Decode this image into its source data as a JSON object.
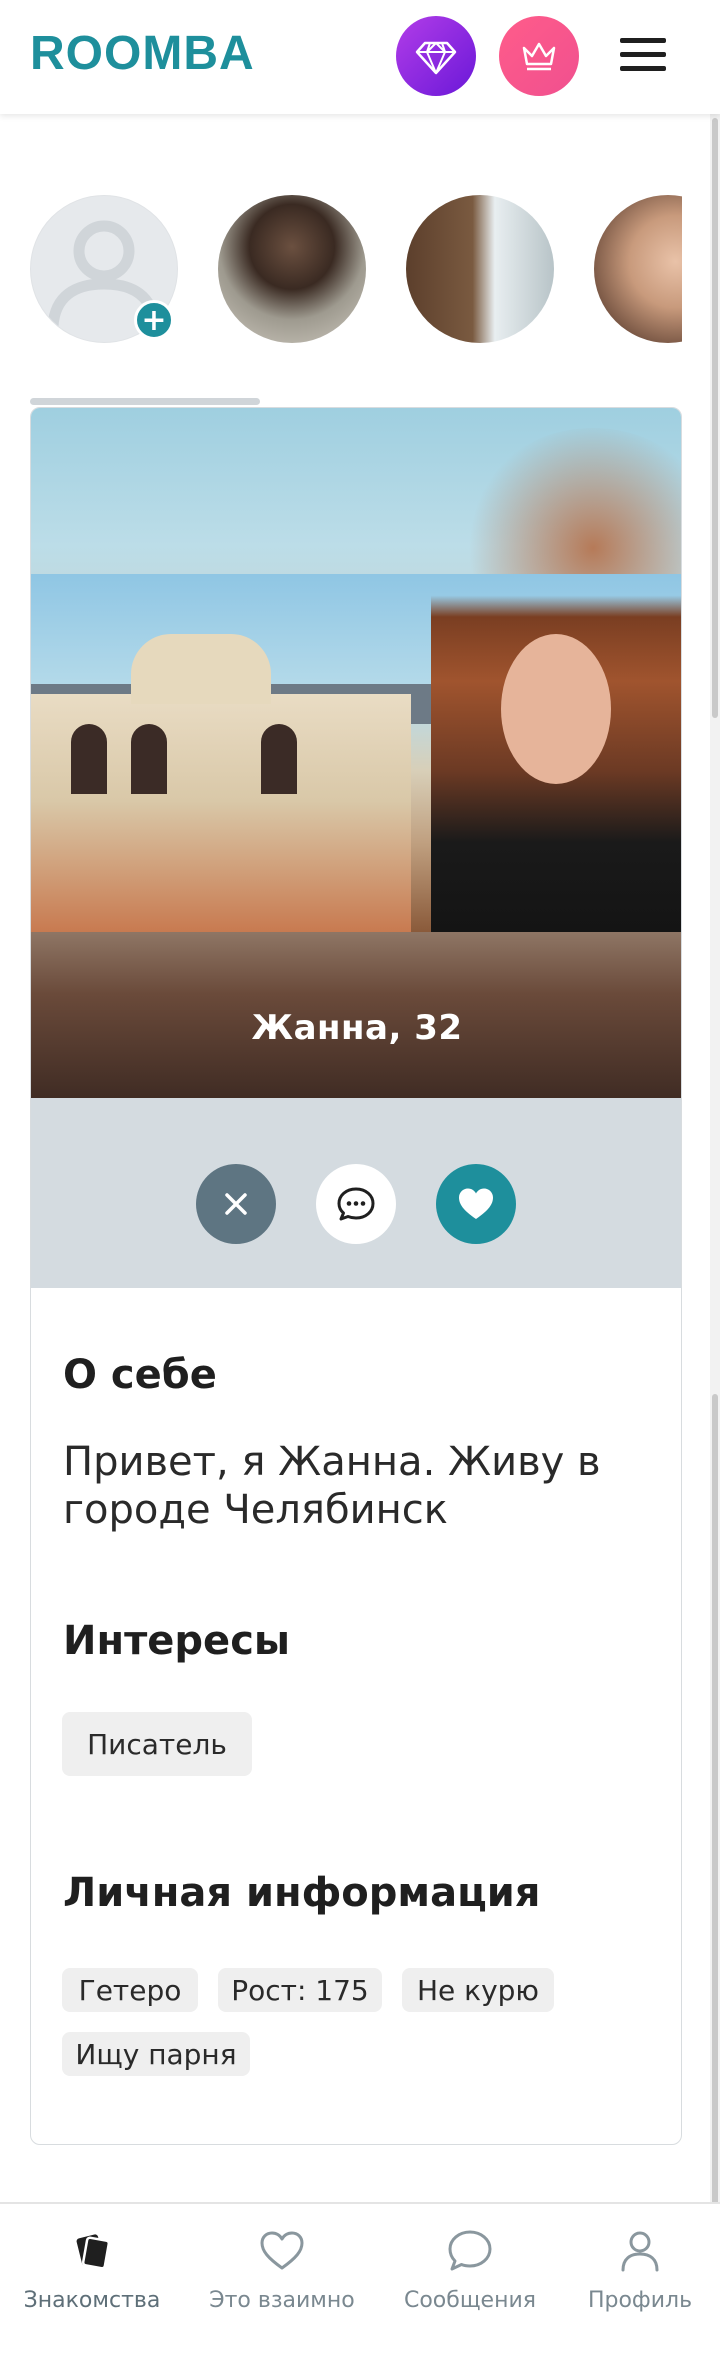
{
  "header": {
    "logo": "ROOMBA",
    "icons": {
      "premium": "diamond-icon",
      "vip": "crown-icon",
      "menu": "hamburger-menu-icon"
    },
    "colors": {
      "brand": "#1e8f9c",
      "premium": "#9b2fe0",
      "vip": "#f4568d"
    }
  },
  "stories": {
    "items": [
      {
        "type": "add-own-story",
        "icon": "user-placeholder-icon",
        "badge_icon": "plus-icon"
      },
      {
        "type": "user-story",
        "icon": "avatar"
      },
      {
        "type": "user-story",
        "icon": "avatar"
      },
      {
        "type": "user-story",
        "icon": "avatar"
      }
    ]
  },
  "profile": {
    "name_age": "Жанна, 32",
    "actions": {
      "dislike_icon": "close-icon",
      "message_icon": "chat-bubble-icon",
      "like_icon": "heart-icon"
    },
    "about_title": "О себе",
    "about_text": "Привет, я Жанна. Живу в городе Челябинск",
    "interests_title": "Интересы",
    "interests": [
      "Писатель"
    ],
    "personal_title": "Личная информация",
    "personal": [
      "Гетеро",
      "Рост: 175",
      "Не курю",
      "Ищу парня"
    ]
  },
  "nav": {
    "items": [
      {
        "label": "Знакомства",
        "icon": "cards-icon",
        "active": true
      },
      {
        "label": "Это взаимно",
        "icon": "heart-outline-icon"
      },
      {
        "label": "Сообщения",
        "icon": "chat-outline-icon"
      },
      {
        "label": "Профиль",
        "icon": "user-outline-icon"
      }
    ]
  }
}
